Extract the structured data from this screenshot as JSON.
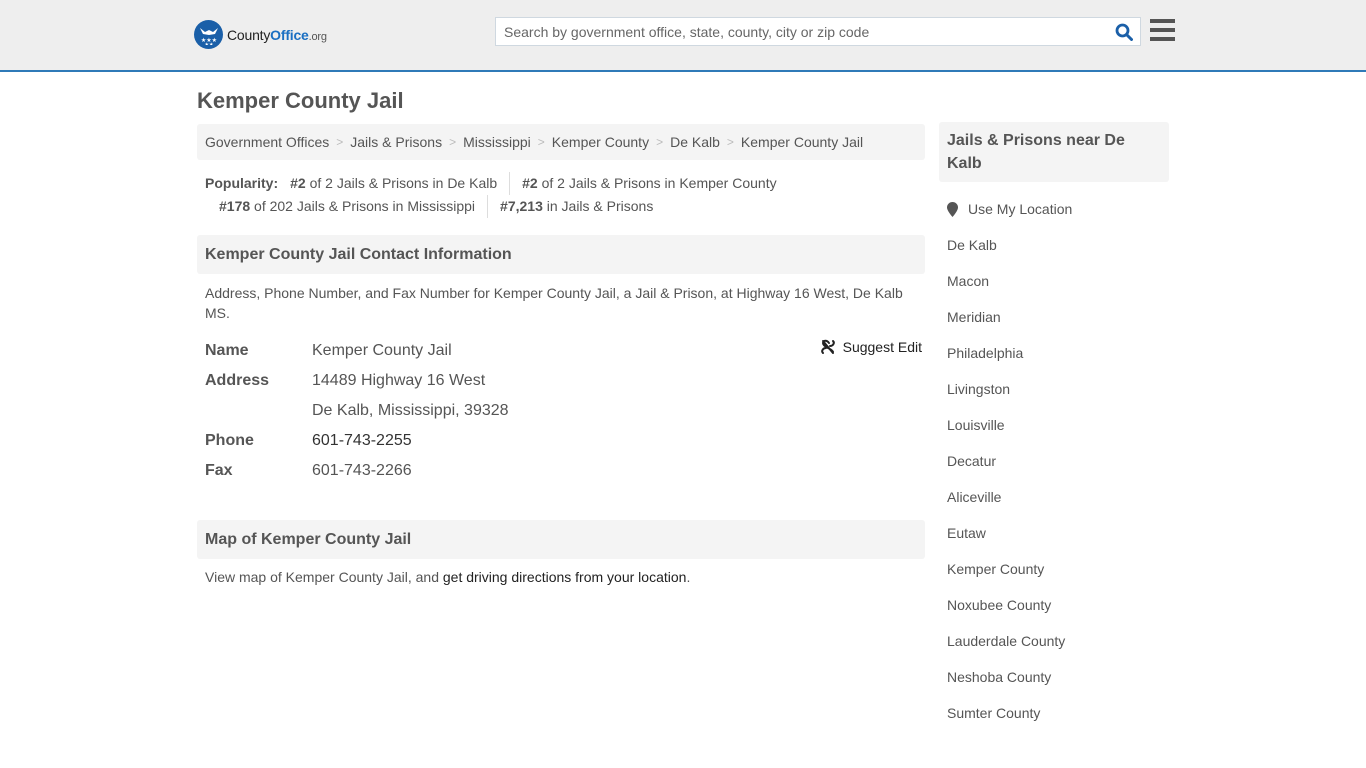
{
  "header": {
    "logo": {
      "county": "County",
      "office": "Office",
      "tld": ".org"
    },
    "search": {
      "placeholder": "Search by government office, state, county, city or zip code",
      "value": ""
    },
    "icons": {
      "search": "search-icon",
      "menu": "hamburger-menu-icon"
    },
    "accent_color": "#2f7ab8"
  },
  "page": {
    "title": "Kemper County Jail"
  },
  "breadcrumb": [
    "Government Offices",
    "Jails & Prisons",
    "Mississippi",
    "Kemper County",
    "De Kalb",
    "Kemper County Jail"
  ],
  "popularity": {
    "label": "Popularity:",
    "items": [
      {
        "rank": "#2",
        "text": "of 2 Jails & Prisons in De Kalb"
      },
      {
        "rank": "#2",
        "text": "of 2 Jails & Prisons in Kemper County"
      },
      {
        "rank": "#178",
        "text": "of 202 Jails & Prisons in Mississippi"
      },
      {
        "rank": "#7,213",
        "text": "in Jails & Prisons"
      }
    ]
  },
  "contact": {
    "heading": "Kemper County Jail Contact Information",
    "description": "Address, Phone Number, and Fax Number for Kemper County Jail, a Jail & Prison, at Highway 16 West, De Kalb MS.",
    "suggest_edit": "Suggest Edit",
    "rows": {
      "name": {
        "label": "Name",
        "value": "Kemper County Jail"
      },
      "address": {
        "label": "Address",
        "line1": "14489 Highway 16 West",
        "line2": "De Kalb, Mississippi, 39328"
      },
      "phone": {
        "label": "Phone",
        "value": "601-743-2255"
      },
      "fax": {
        "label": "Fax",
        "value": "601-743-2266"
      }
    }
  },
  "map": {
    "heading": "Map of Kemper County Jail",
    "text_before": "View map of Kemper County Jail, and ",
    "link": "get driving directions from your location",
    "text_after": "."
  },
  "sidebar": {
    "heading": "Jails & Prisons near De Kalb",
    "use_location": "Use My Location",
    "links": [
      "De Kalb",
      "Macon",
      "Meridian",
      "Philadelphia",
      "Livingston",
      "Louisville",
      "Decatur",
      "Aliceville",
      "Eutaw",
      "Kemper County",
      "Noxubee County",
      "Lauderdale County",
      "Neshoba County",
      "Sumter County"
    ]
  }
}
